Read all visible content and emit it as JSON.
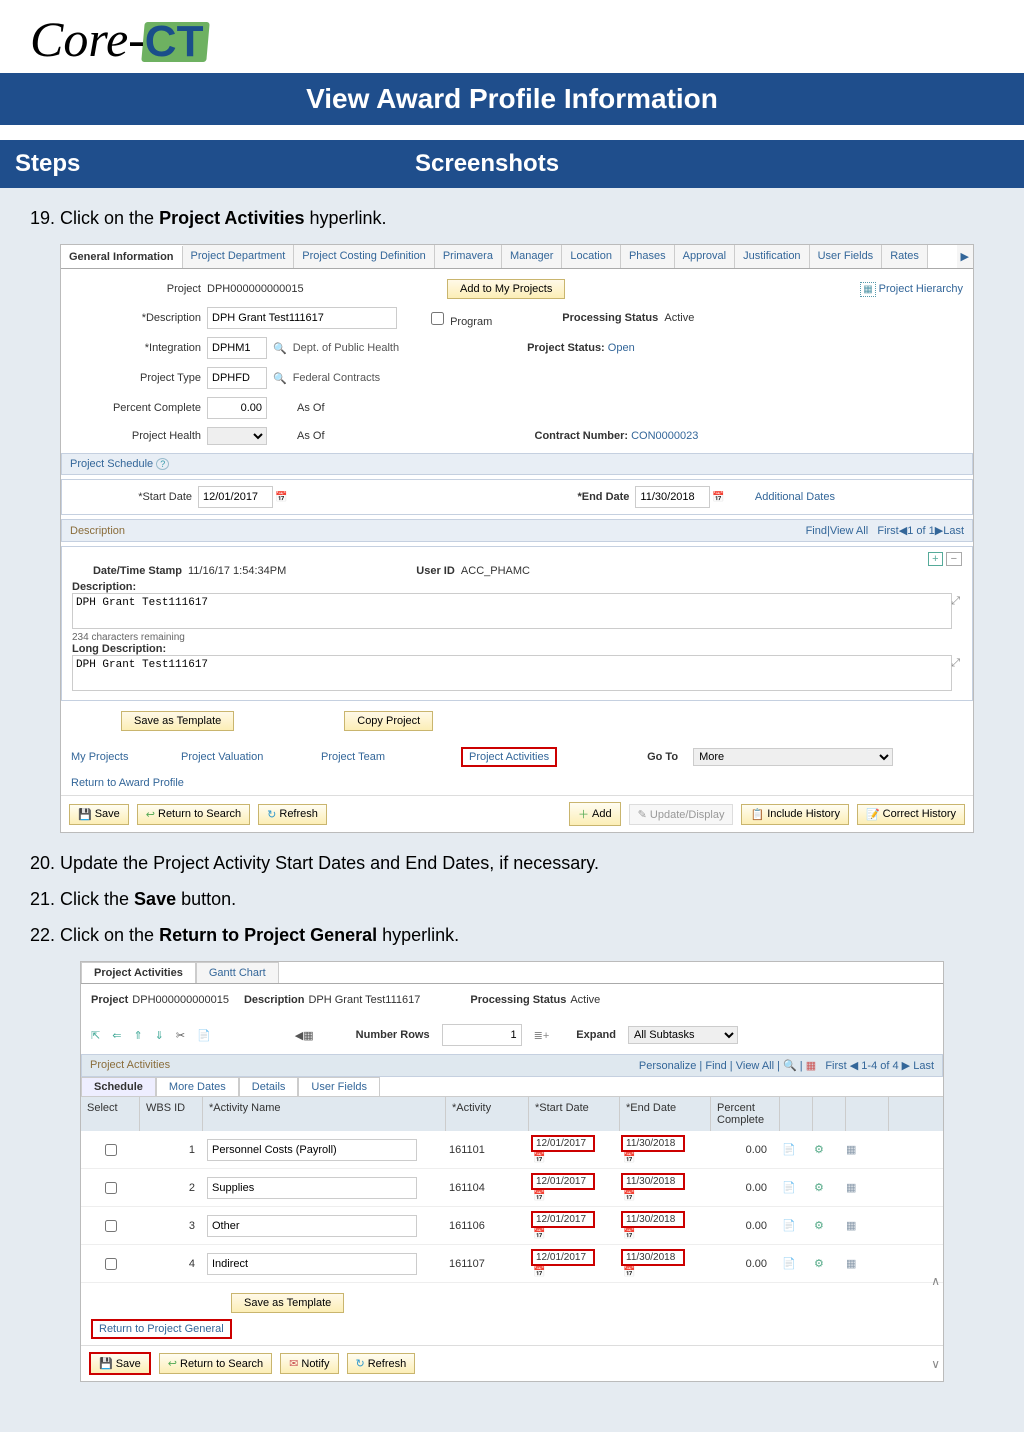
{
  "header": {
    "logo_core": "Core-",
    "logo_ct": "CT",
    "title": "View Award Profile Information",
    "steps_label": "Steps",
    "screenshots_label": "Screenshots"
  },
  "steps": {
    "s19a": "19. Click on the ",
    "s19b": "Project Activities",
    "s19c": " hyperlink.",
    "s20": "20. Update the Project Activity Start Dates and End Dates, if necessary.",
    "s21a": "21. Click the ",
    "s21b": "Save",
    "s21c": " button.",
    "s22a": "22. Click on the ",
    "s22b": "Return to Project General",
    "s22c": " hyperlink."
  },
  "shot1": {
    "tabs": [
      "General Information",
      "Project Department",
      "Project Costing Definition",
      "Primavera",
      "Manager",
      "Location",
      "Phases",
      "Approval",
      "Justification",
      "User Fields",
      "Rates"
    ],
    "project_lbl": "Project",
    "project_val": "DPH000000000015",
    "add_projects": "Add to My Projects",
    "hierarchy": "Project Hierarchy",
    "desc_lbl": "*Description",
    "desc_val": "DPH Grant Test111617",
    "program": "Program",
    "proc_status_lbl": "Processing Status",
    "proc_status_val": "Active",
    "integration_lbl": "*Integration",
    "integration_val": "DPHM1",
    "integration_txt": "Dept. of Public Health",
    "proj_status_lbl": "Project Status:",
    "proj_status_val": "Open",
    "ptype_lbl": "Project Type",
    "ptype_val": "DPHFD",
    "ptype_txt": "Federal Contracts",
    "pct_lbl": "Percent Complete",
    "pct_val": "0.00",
    "asof": "As Of",
    "phealth_lbl": "Project Health",
    "contract_lbl": "Contract Number:",
    "contract_val": "CON0000023",
    "schedule": "Project Schedule",
    "start_lbl": "*Start Date",
    "start_val": "12/01/2017",
    "end_lbl": "*End Date",
    "end_val": "11/30/2018",
    "add_dates": "Additional Dates",
    "description": "Description",
    "find": "Find",
    "viewall": "View All",
    "first": "First",
    "pager": "1 of 1",
    "last": "Last",
    "dt_lbl": "Date/Time Stamp",
    "dt_val": "11/16/17  1:54:34PM",
    "user_lbl": "User ID",
    "user_val": "ACC_PHAMC",
    "desc_label": "Description:",
    "desc_text": "DPH Grant Test111617",
    "remain": "234 characters remaining",
    "long_label": "Long Description:",
    "long_text": "DPH Grant Test111617",
    "save_tpl": "Save as Template",
    "copy": "Copy Project",
    "links": {
      "my": "My Projects",
      "valuation": "Project Valuation",
      "team": "Project Team",
      "activities": "Project Activities"
    },
    "goto": "Go To",
    "more": "More",
    "return_award": "Return to Award Profile",
    "save": "Save",
    "return_search": "Return to Search",
    "refresh": "Refresh",
    "add": "Add",
    "update": "Update/Display",
    "include": "Include History",
    "correct": "Correct History"
  },
  "shot2": {
    "tab1": "Project Activities",
    "tab2": "Gantt Chart",
    "project_lbl": "Project",
    "project_val": "DPH000000000015",
    "desc_lbl": "Description",
    "desc_val": "DPH Grant Test111617",
    "proc_lbl": "Processing Status",
    "proc_val": "Active",
    "numrows": "Number Rows",
    "numrows_val": "1",
    "expand": "Expand",
    "expand_val": "All Subtasks",
    "grid_title": "Project Activities",
    "personalize": "Personalize",
    "find": "Find",
    "viewall": "View All",
    "first": "First",
    "pager": "1-4 of 4",
    "last": "Last",
    "subtabs": [
      "Schedule",
      "More Dates",
      "Details",
      "User Fields"
    ],
    "cols": {
      "select": "Select",
      "wbs": "WBS ID",
      "name": "*Activity Name",
      "act": "*Activity",
      "start": "*Start Date",
      "end": "*End Date",
      "pct": "Percent Complete"
    },
    "rows": [
      {
        "wbs": "1",
        "name": "Personnel Costs (Payroll)",
        "act": "161101",
        "start": "12/01/2017",
        "end": "11/30/2018",
        "pct": "0.00"
      },
      {
        "wbs": "2",
        "name": "Supplies",
        "act": "161104",
        "start": "12/01/2017",
        "end": "11/30/2018",
        "pct": "0.00"
      },
      {
        "wbs": "3",
        "name": "Other",
        "act": "161106",
        "start": "12/01/2017",
        "end": "11/30/2018",
        "pct": "0.00"
      },
      {
        "wbs": "4",
        "name": "Indirect",
        "act": "161107",
        "start": "12/01/2017",
        "end": "11/30/2018",
        "pct": "0.00"
      }
    ],
    "save_tpl": "Save as Template",
    "return_gen": "Return to Project General",
    "save": "Save",
    "return_search": "Return to Search",
    "notify": "Notify",
    "refresh": "Refresh"
  }
}
